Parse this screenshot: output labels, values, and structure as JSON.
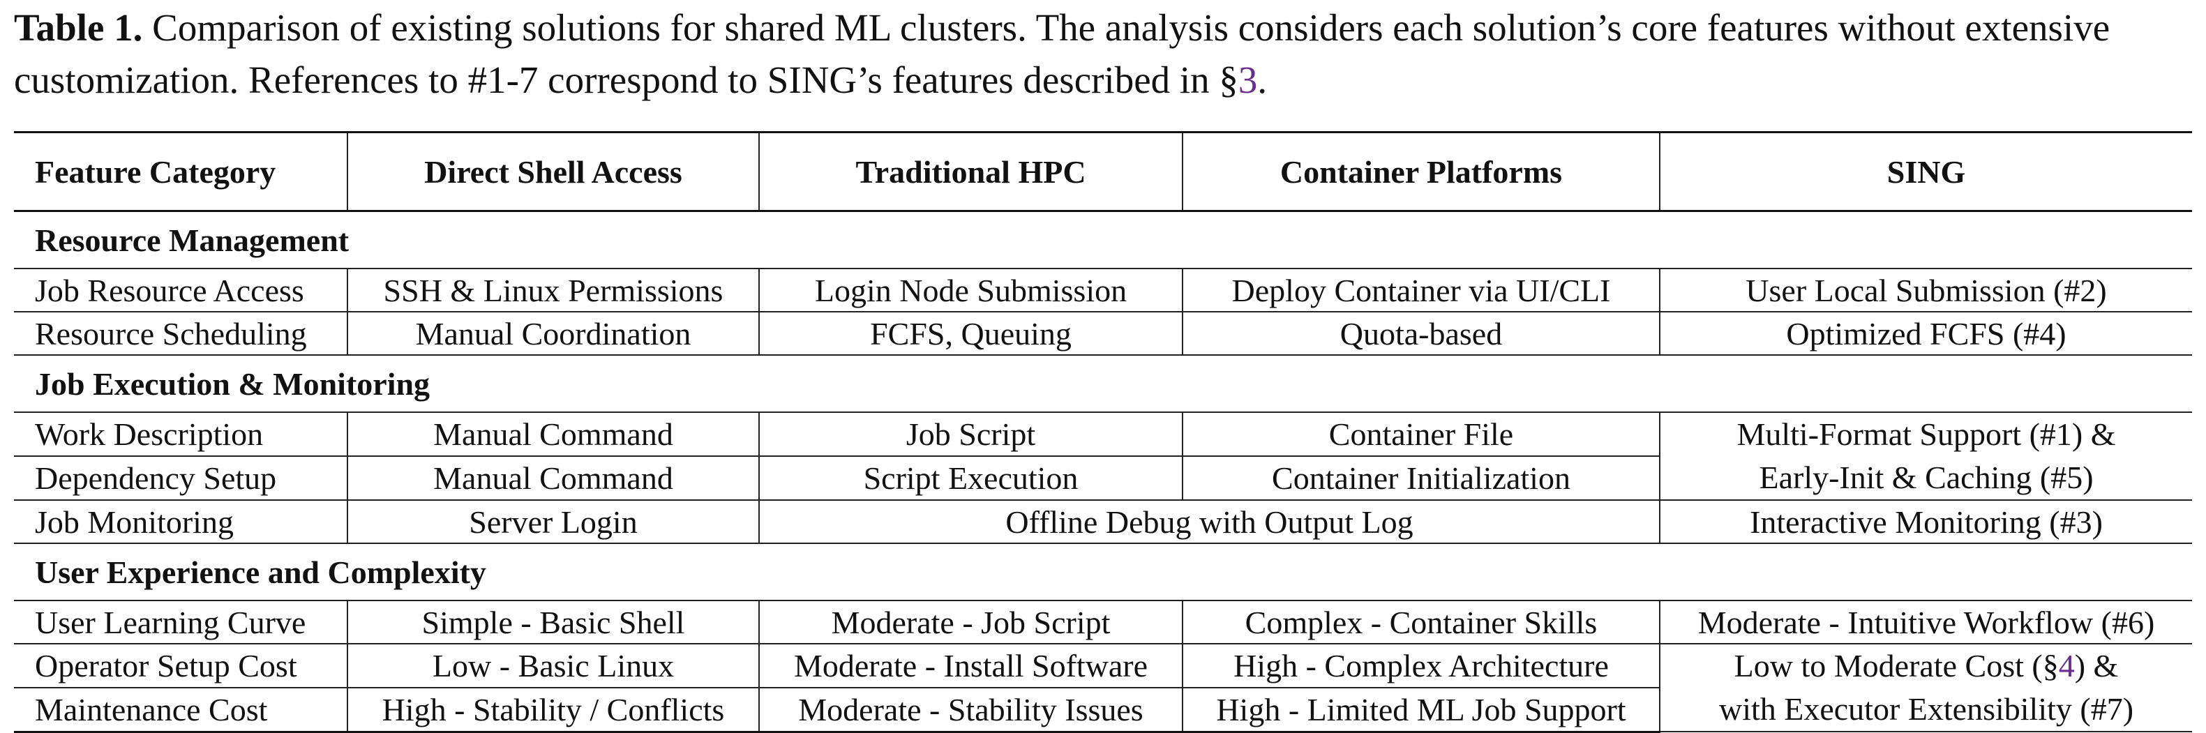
{
  "caption": {
    "label": "Table 1.",
    "text_before_ref1": "Comparison of existing solutions for shared ML clusters. The analysis considers each solution’s core features without extensive customization. References to #1-7 correspond to SING’s features described in §",
    "ref1": "3",
    "text_after_ref1": "."
  },
  "table": {
    "headers": [
      "Feature Category",
      "Direct Shell Access",
      "Traditional HPC",
      "Container Platforms",
      "SING"
    ],
    "sections": {
      "resource": {
        "title": "Resource Management",
        "job_resource_access": [
          "Job Resource Access",
          "SSH & Linux Permissions",
          "Login Node Submission",
          "Deploy Container via UI/CLI",
          "User Local Submission (#2)"
        ],
        "resource_scheduling": [
          "Resource Scheduling",
          "Manual Coordination",
          "FCFS, Queuing",
          "Quota-based",
          "Optimized FCFS (#4)"
        ]
      },
      "execution": {
        "title": "Job Execution & Monitoring",
        "work_description": [
          "Work Description",
          "Manual Command",
          "Job Script",
          "Container File"
        ],
        "dependency_setup": [
          "Dependency Setup",
          "Manual Command",
          "Script Execution",
          "Container Initialization"
        ],
        "sing_merged_line1": "Multi-Format Support (#1) &",
        "sing_merged_line2": "Early-Init & Caching (#5)",
        "job_monitoring": [
          "Job Monitoring",
          "Server Login",
          "Offline Debug with Output Log",
          "Interactive Monitoring (#3)"
        ]
      },
      "ux": {
        "title": "User Experience and Complexity",
        "user_learning_curve": [
          "User Learning Curve",
          "Simple - Basic Shell",
          "Moderate - Job Script",
          "Complex - Container Skills",
          "Moderate - Intuitive Workflow (#6)"
        ],
        "operator_setup_cost": [
          "Operator Setup Cost",
          "Low - Basic Linux",
          "Moderate - Install Software",
          "High - Complex Architecture"
        ],
        "maintenance_cost": [
          "Maintenance Cost",
          "High - Stability / Conflicts",
          "Moderate - Stability Issues",
          "High - Limited ML Job Support"
        ],
        "sing_merged_line1_before_ref": "Low to Moderate Cost (§",
        "sing_merged_ref": "4",
        "sing_merged_line1_after_ref": ") &",
        "sing_merged_line2": "with Executor Extensibility (#7)"
      }
    }
  }
}
